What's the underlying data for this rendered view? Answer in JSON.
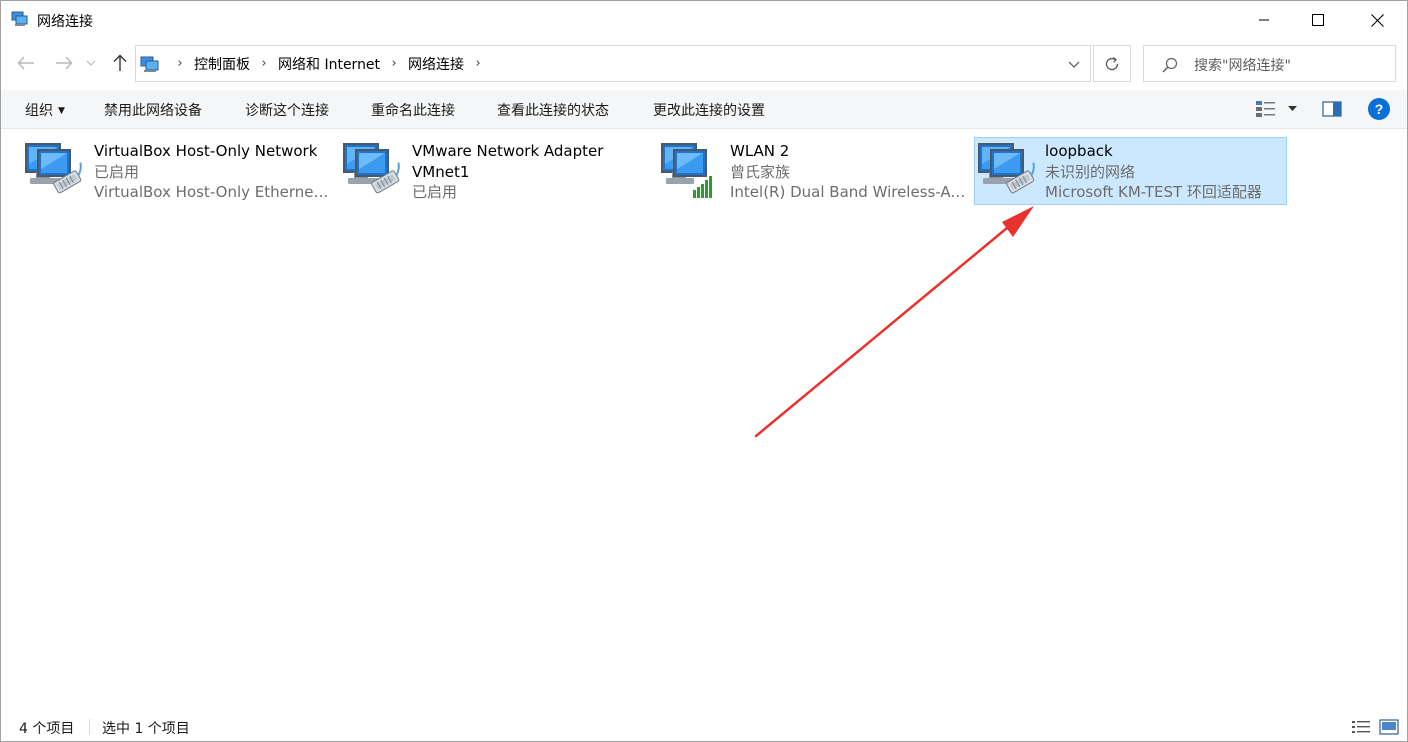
{
  "window": {
    "title": "网络连接"
  },
  "address": {
    "crumbs": [
      "控制面板",
      "网络和 Internet",
      "网络连接"
    ]
  },
  "search": {
    "placeholder": "搜索\"网络连接\""
  },
  "commands": {
    "organize": "组织",
    "disable": "禁用此网络设备",
    "diagnose": "诊断这个连接",
    "rename": "重命名此连接",
    "status": "查看此连接的状态",
    "settings": "更改此连接的设置"
  },
  "adapters": [
    {
      "name": "VirtualBox Host-Only Network",
      "status": "已启用",
      "device": "VirtualBox Host-Only Ethernet ...",
      "icon": "wired-network-icon",
      "selected": false
    },
    {
      "name": "VMware Network Adapter VMnet1",
      "status": "已启用",
      "device": "",
      "icon": "wired-network-icon",
      "selected": false
    },
    {
      "name": "WLAN 2",
      "status": "曾氏家族",
      "device": "Intel(R) Dual Band Wireless-AC...",
      "icon": "wireless-network-icon",
      "selected": false
    },
    {
      "name": "loopback",
      "status": "未识别的网络",
      "device": "Microsoft KM-TEST 环回适配器",
      "icon": "wired-network-icon",
      "selected": true
    }
  ],
  "statusbar": {
    "items_count": "4 个项目",
    "selected_count": "选中 1 个项目"
  },
  "colors": {
    "selection_bg": "#cce8ff",
    "selection_border": "#99d1ff",
    "annotation_arrow": "#e8322e",
    "help_blue": "#0a6fd6"
  }
}
